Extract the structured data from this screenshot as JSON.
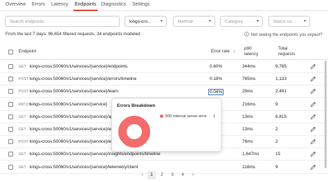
{
  "tabs": [
    {
      "label": "Overview"
    },
    {
      "label": "Errors"
    },
    {
      "label": "Latency"
    },
    {
      "label": "Endpoints"
    },
    {
      "label": "Diagnostics"
    },
    {
      "label": "Settings"
    }
  ],
  "filters": {
    "search_placeholder": "Search endpoints",
    "service_value": "kings-cro...",
    "method_placeholder": "Method",
    "category_placeholder": "Category",
    "status_placeholder": "Status co..."
  },
  "summary": "From the last 7 days: 96,654 filtered requests, 34 endpoints modeled",
  "help_link": "Not seeing the endpoints you expect?",
  "columns": {
    "endpoint": "Endpoint",
    "error_rate": "Error rate",
    "sort_arrow": "↓",
    "p90_line1": "p90",
    "p90_line2": "latency",
    "total_line1": "Total",
    "total_line2": "requests"
  },
  "rows": [
    {
      "method": "GET",
      "path": "kings-cross:50060/v1/services/{service}/endpoints",
      "error_rate": "0.60%",
      "latency": "344ms",
      "requests": "9,785"
    },
    {
      "method": "POST",
      "path": "kings-cross:50060/v1/services/{service}/errors/timeline",
      "error_rate": "0.18%",
      "latency": "765ms",
      "requests": "1,133"
    },
    {
      "method": "POST",
      "path": "kings-cross:50060/v1/services/{service}/learn",
      "error_rate": "0.04%",
      "latency": "29ms",
      "requests": "2,491"
    },
    {
      "method": "PATCH",
      "path": "kings-cross:50060/v1/services/{service}",
      "error_rate": "",
      "latency": "216ms",
      "requests": "9"
    },
    {
      "method": "GET",
      "path": "kings-cross:50060/v1/services/{service}/ap",
      "error_rate": "",
      "latency": "13ms",
      "requests": "6,815"
    },
    {
      "method": "GET",
      "path": "kings-cross:50060/v1/services/{service}/en",
      "error_rate": "",
      "latency": "13ms",
      "requests": "2"
    },
    {
      "method": "POST",
      "path": "kings-cross:50060/v1/services/{service}/en",
      "error_rate": "",
      "latency": "76ms",
      "requests": "2"
    },
    {
      "method": "GET",
      "path": "kings-cross:50060/v1/services/{service}/insights/endpoints/timeline",
      "error_rate": "",
      "latency": "1,647ms",
      "requests": "15"
    },
    {
      "method": "GET",
      "path": "kings-cross:50060/v1/services/{service}/telemetry/client",
      "error_rate": "",
      "latency": "118ms",
      "requests": "9"
    }
  ],
  "tooltip": {
    "title": "Errors Breakdown",
    "legend_label": "500 Internal server error",
    "legend_count": "1",
    "segment_color": "#f46b6b"
  },
  "pagination": {
    "prev": "‹",
    "pages": [
      "1",
      "2",
      "3",
      "4"
    ],
    "next": "›",
    "current": "1"
  },
  "colors": {
    "accent": "#e8442e",
    "focus": "#3d7bd9"
  }
}
